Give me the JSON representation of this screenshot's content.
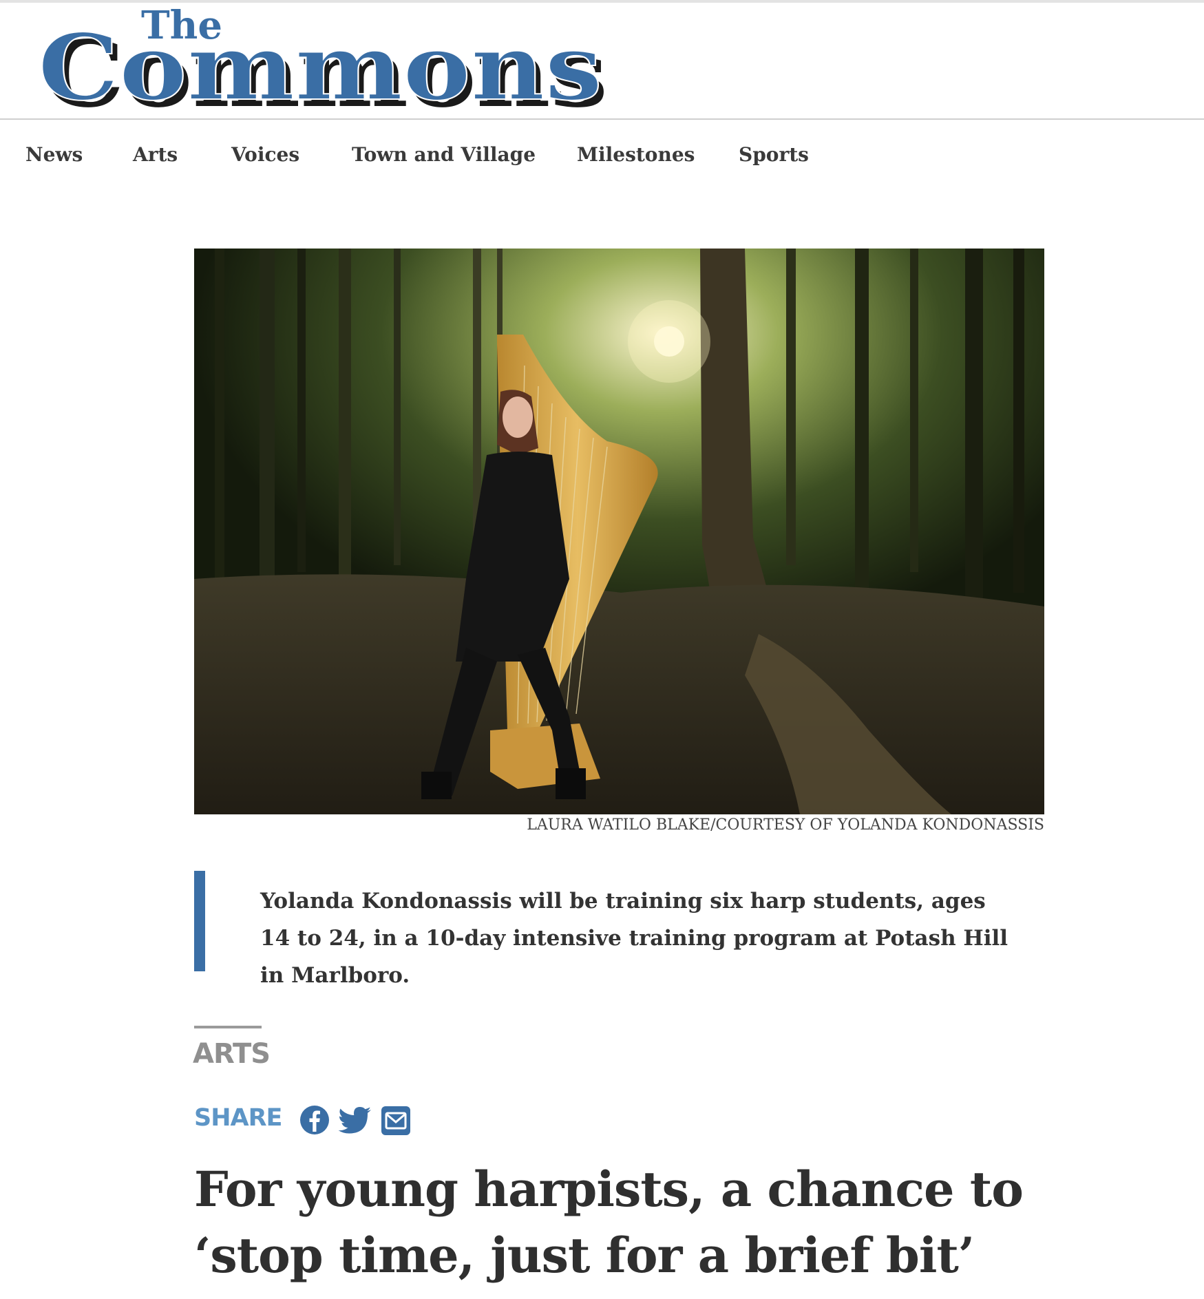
{
  "site": {
    "logo_small": "The",
    "logo_main": "Commons"
  },
  "nav": {
    "items": [
      {
        "label": "News"
      },
      {
        "label": "Arts"
      },
      {
        "label": "Voices"
      },
      {
        "label": "Town and Village"
      },
      {
        "label": "Milestones"
      },
      {
        "label": "Sports"
      }
    ]
  },
  "article": {
    "photo_credit": "LAURA WATILO BLAKE/COURTESY OF YOLANDA KONDONASSIS",
    "caption": "Yolanda Kondonassis will be training six harp students, ages 14 to 24, in a 10-day intensive training program at Potash Hill in Marlboro.",
    "section": "ARTS",
    "share_label": "SHARE",
    "headline": "For young harpists, a chance to ‘stop time, just for a brief bit’"
  },
  "colors": {
    "brand_blue": "#3a6ea5",
    "share_blue": "#5d95c6"
  },
  "icons": {
    "share": [
      "facebook-icon",
      "twitter-icon",
      "email-icon"
    ]
  }
}
